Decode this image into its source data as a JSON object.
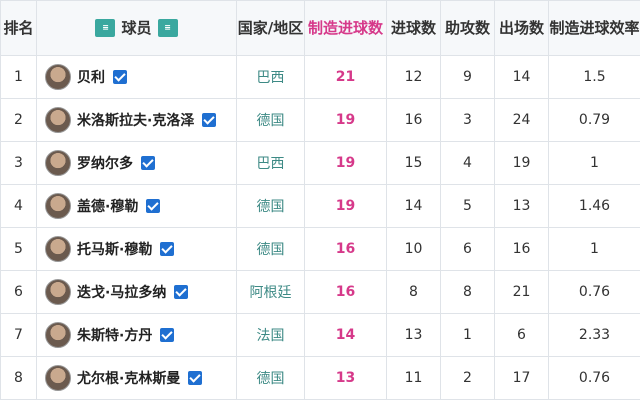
{
  "table": {
    "headers": {
      "rank": "排名",
      "player": "球员",
      "country": "国家/地区",
      "created_goals": "制造进球数",
      "goals": "进球数",
      "assists": "助攻数",
      "apps": "出场数",
      "efficiency": "制造进球效率"
    },
    "rows": [
      {
        "rank": "1",
        "name": "贝利",
        "verified": true,
        "country": "巴西",
        "created": "21",
        "goals": "12",
        "assists": "9",
        "apps": "14",
        "eff": "1.5"
      },
      {
        "rank": "2",
        "name": "米洛斯拉夫·克洛泽",
        "verified": true,
        "country": "德国",
        "created": "19",
        "goals": "16",
        "assists": "3",
        "apps": "24",
        "eff": "0.79"
      },
      {
        "rank": "3",
        "name": "罗纳尔多",
        "verified": true,
        "country": "巴西",
        "created": "19",
        "goals": "15",
        "assists": "4",
        "apps": "19",
        "eff": "1"
      },
      {
        "rank": "4",
        "name": "盖德·穆勒",
        "verified": true,
        "country": "德国",
        "created": "19",
        "goals": "14",
        "assists": "5",
        "apps": "13",
        "eff": "1.46"
      },
      {
        "rank": "5",
        "name": "托马斯·穆勒",
        "verified": true,
        "country": "德国",
        "created": "16",
        "goals": "10",
        "assists": "6",
        "apps": "16",
        "eff": "1"
      },
      {
        "rank": "6",
        "name": "迭戈·马拉多纳",
        "verified": true,
        "country": "阿根廷",
        "created": "16",
        "goals": "8",
        "assists": "8",
        "apps": "21",
        "eff": "0.76"
      },
      {
        "rank": "7",
        "name": "朱斯特·方丹",
        "verified": true,
        "country": "法国",
        "created": "14",
        "goals": "13",
        "assists": "1",
        "apps": "6",
        "eff": "2.33"
      },
      {
        "rank": "8",
        "name": "尤尔根·克林斯曼",
        "verified": true,
        "country": "德国",
        "created": "13",
        "goals": "11",
        "assists": "2",
        "apps": "17",
        "eff": "0.76"
      }
    ]
  },
  "colors": {
    "highlight": "#d6398a",
    "country": "#3d8a85",
    "check": "#1f6fd1"
  },
  "icons": {
    "sort": "sort-icon",
    "verified": "checkbox-checked-icon",
    "avatar": "player-avatar"
  }
}
